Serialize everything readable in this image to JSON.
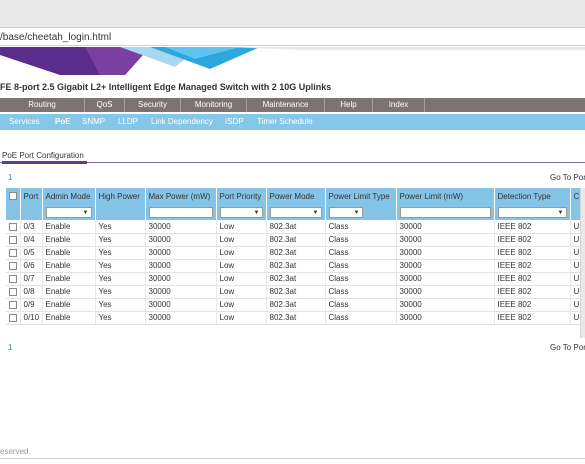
{
  "address": {
    "url": "/base/cheetah_login.html"
  },
  "page_title": "FE 8-port 2.5 Gigabit L2+ Intelligent Edge Managed Switch with 2 10G Uplinks",
  "main_nav": [
    "Routing",
    "QoS",
    "Security",
    "Monitoring",
    "Maintenance",
    "Help",
    "Index"
  ],
  "sub_nav": [
    "Services",
    "PoE",
    "SNMP",
    "LLDP",
    "Link Dependency",
    "ISDP",
    "Timer Schedule"
  ],
  "active_sub_nav": "PoE",
  "tab_label": "PoE Port Configuration",
  "pagination": {
    "page": "1",
    "go_to": "Go To Por"
  },
  "table": {
    "headers": [
      "Port",
      "Admin Mode",
      "High Power",
      "Max Power (mW)",
      "Port Priority",
      "Power Mode",
      "Power Limit Type",
      "Power Limit (mW)",
      "Detection Type",
      "C"
    ],
    "rows": [
      {
        "port": "0/3",
        "admin": "Enable",
        "high": "Yes",
        "max": "30000",
        "prio": "Low",
        "mode": "802.3at",
        "limit_type": "Class",
        "limit": "30000",
        "detect": "IEEE 802",
        "c": "U"
      },
      {
        "port": "0/4",
        "admin": "Enable",
        "high": "Yes",
        "max": "30000",
        "prio": "Low",
        "mode": "802.3at",
        "limit_type": "Class",
        "limit": "30000",
        "detect": "IEEE 802",
        "c": "U"
      },
      {
        "port": "0/5",
        "admin": "Enable",
        "high": "Yes",
        "max": "30000",
        "prio": "Low",
        "mode": "802.3at",
        "limit_type": "Class",
        "limit": "30000",
        "detect": "IEEE 802",
        "c": "U"
      },
      {
        "port": "0/6",
        "admin": "Enable",
        "high": "Yes",
        "max": "30000",
        "prio": "Low",
        "mode": "802.3at",
        "limit_type": "Class",
        "limit": "30000",
        "detect": "IEEE 802",
        "c": "U"
      },
      {
        "port": "0/7",
        "admin": "Enable",
        "high": "Yes",
        "max": "30000",
        "prio": "Low",
        "mode": "802.3at",
        "limit_type": "Class",
        "limit": "30000",
        "detect": "IEEE 802",
        "c": "U"
      },
      {
        "port": "0/8",
        "admin": "Enable",
        "high": "Yes",
        "max": "30000",
        "prio": "Low",
        "mode": "802.3at",
        "limit_type": "Class",
        "limit": "30000",
        "detect": "IEEE 802",
        "c": "U"
      },
      {
        "port": "0/9",
        "admin": "Enable",
        "high": "Yes",
        "max": "30000",
        "prio": "Low",
        "mode": "802.3at",
        "limit_type": "Class",
        "limit": "30000",
        "detect": "IEEE 802",
        "c": "U"
      },
      {
        "port": "0/10",
        "admin": "Enable",
        "high": "Yes",
        "max": "30000",
        "prio": "Low",
        "mode": "802.3at",
        "limit_type": "Class",
        "limit": "30000",
        "detect": "IEEE 802",
        "c": "U"
      }
    ]
  },
  "footer": "eserved.",
  "colors": {
    "main_nav": "#7d7271",
    "sub_nav": "#85c7e8",
    "table_header": "#84c4e7",
    "brand_purple": "#5a2d8c",
    "active_tab": "#5a3e8c"
  },
  "icons": {
    "dropdown": "chevron-down-icon",
    "checkbox": "checkbox-icon"
  }
}
